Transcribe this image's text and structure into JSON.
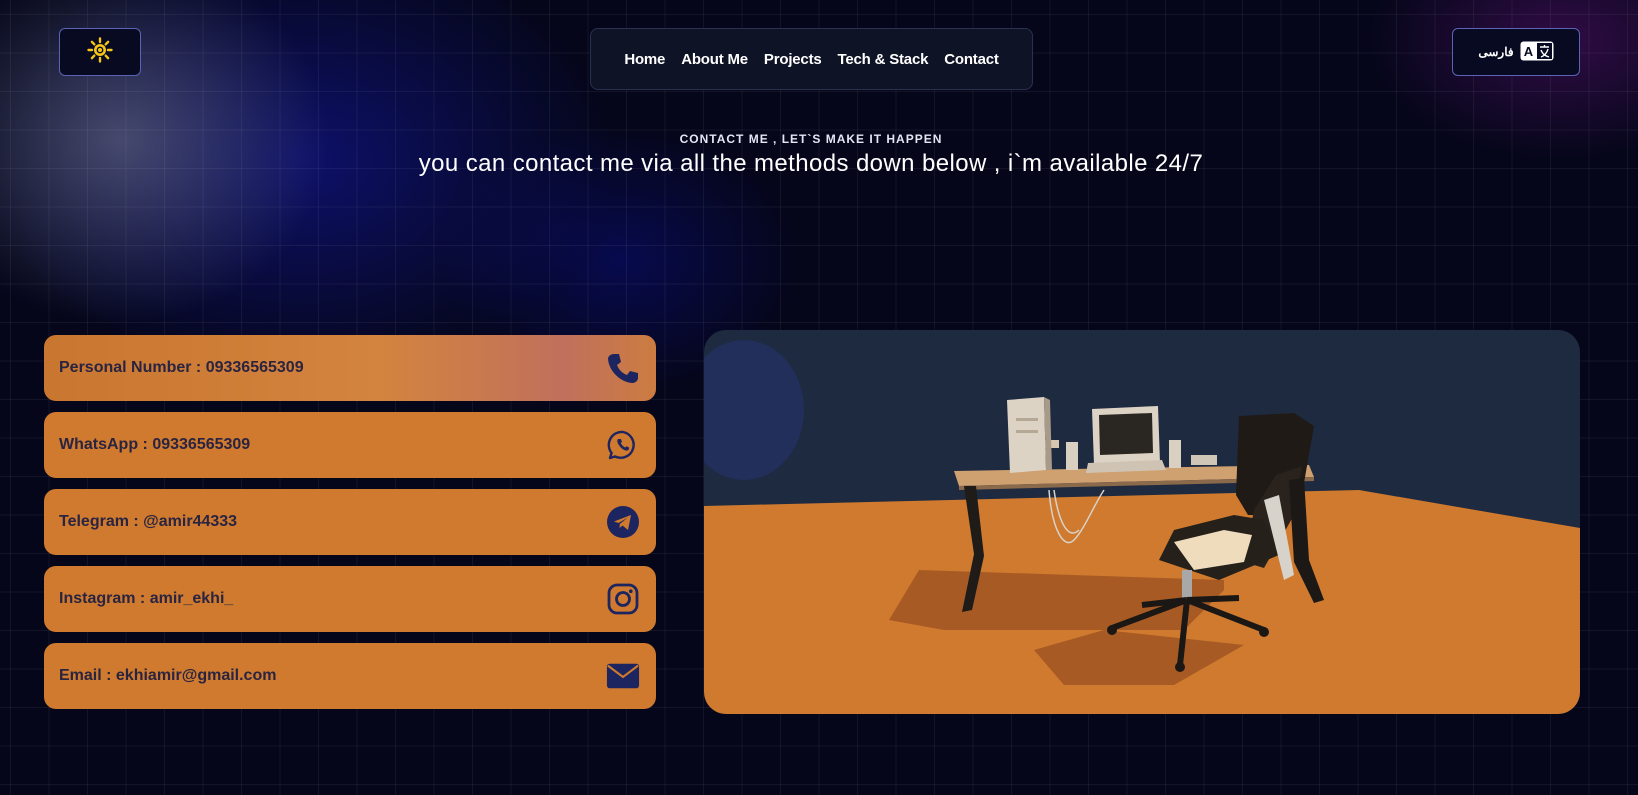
{
  "theme_toggle": {
    "icon": "sun-icon",
    "color": "#f5c518"
  },
  "nav": {
    "items": [
      {
        "label": "Home"
      },
      {
        "label": "About Me"
      },
      {
        "label": "Projects"
      },
      {
        "label": "Tech & Stack"
      },
      {
        "label": "Contact"
      }
    ]
  },
  "language_toggle": {
    "label": "فارسی",
    "icon": "translate-icon"
  },
  "header": {
    "eyebrow": "CONTACT ME , LET`S MAKE IT HAPPEN",
    "headline": "you can contact me via all the methods down below , i`m available 24/7"
  },
  "contacts": [
    {
      "label": "Personal Number : 09336565309",
      "icon": "phone-icon"
    },
    {
      "label": "WhatsApp : 09336565309",
      "icon": "whatsapp-icon"
    },
    {
      "label": "Telegram : @amir44333",
      "icon": "telegram-icon"
    },
    {
      "label": "Instagram : amir_ekhi_",
      "icon": "instagram-icon"
    },
    {
      "label": "Email : ekhiamir@gmail.com",
      "icon": "mail-icon"
    }
  ],
  "scene": {
    "description_icon": "desk-chair-3d-scene"
  },
  "colors": {
    "background": "#05061a",
    "card": "#cf7a2e",
    "card_text": "#2a2440",
    "icon": "#1d2560",
    "scene_wall": "#1e2a40",
    "scene_floor": "#cf7a2e"
  }
}
